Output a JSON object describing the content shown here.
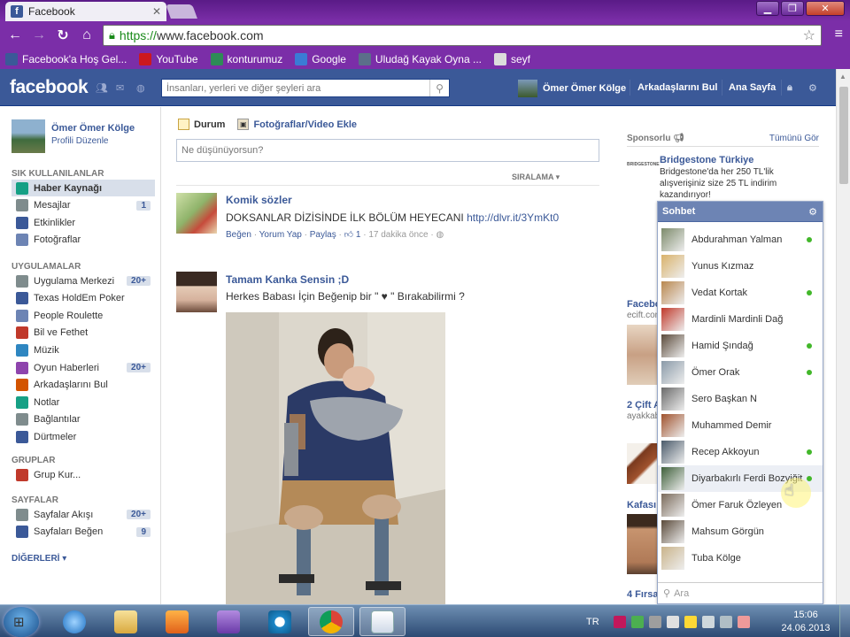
{
  "browser": {
    "tab_title": "Facebook",
    "url_scheme": "https://",
    "url_rest": "www.facebook.com",
    "bookmarks": [
      {
        "label": "Facebook'a Hoş Gel...",
        "icon": "facebook-icon",
        "color": "#3b5998"
      },
      {
        "label": "YouTube",
        "icon": "youtube-icon",
        "color": "#cc181e"
      },
      {
        "label": "konturumuz",
        "icon": "clover-icon",
        "color": "#2e8b57"
      },
      {
        "label": "Google",
        "icon": "google-icon",
        "color": "#3a7bd5"
      },
      {
        "label": "Uludağ Kayak Oyna ...",
        "icon": "ok-icon",
        "color": "#5b6f8a"
      },
      {
        "label": "seyf",
        "icon": "page-icon",
        "color": "#dcdcdc"
      }
    ]
  },
  "fb": {
    "logo": "facebook",
    "search_placeholder": "İnsanları, yerleri ve diğer şeyleri ara",
    "user_name": "Ömer Ömer Kölge",
    "nav_find_friends": "Arkadaşlarını Bul",
    "nav_home": "Ana Sayfa"
  },
  "left": {
    "profile_name": "Ömer Ömer Kölge",
    "profile_edit": "Profili Düzenle",
    "favorites_header": "SIK KULLANILANLAR",
    "favorites": [
      {
        "label": "Haber Kaynağı",
        "icon": "news-feed-icon",
        "count": ""
      },
      {
        "label": "Mesajlar",
        "icon": "messages-icon",
        "count": "1"
      },
      {
        "label": "Etkinlikler",
        "icon": "events-icon",
        "count": ""
      },
      {
        "label": "Fotoğraflar",
        "icon": "photos-icon",
        "count": ""
      }
    ],
    "apps_header": "UYGULAMALAR",
    "apps": [
      {
        "label": "Uygulama Merkezi",
        "icon": "app-center-icon",
        "count": "20+"
      },
      {
        "label": "Texas HoldEm Poker",
        "icon": "poker-chip-icon",
        "count": ""
      },
      {
        "label": "People Roulette",
        "icon": "roulette-icon",
        "count": ""
      },
      {
        "label": "Bil ve Fethet",
        "icon": "knight-icon",
        "count": ""
      },
      {
        "label": "Müzik",
        "icon": "music-icon",
        "count": ""
      },
      {
        "label": "Oyun Haberleri",
        "icon": "game-news-icon",
        "count": "20+"
      },
      {
        "label": "Arkadaşlarını Bul",
        "icon": "find-friends-icon",
        "count": ""
      },
      {
        "label": "Notlar",
        "icon": "notes-icon",
        "count": ""
      },
      {
        "label": "Bağlantılar",
        "icon": "links-icon",
        "count": ""
      },
      {
        "label": "Dürtmeler",
        "icon": "pokes-icon",
        "count": ""
      }
    ],
    "groups_header": "GRUPLAR",
    "groups": [
      {
        "label": "Grup Kur...",
        "icon": "create-group-icon",
        "count": ""
      }
    ],
    "pages_header": "SAYFALAR",
    "pages": [
      {
        "label": "Sayfalar Akışı",
        "icon": "pages-feed-icon",
        "count": "20+"
      },
      {
        "label": "Sayfaları Beğen",
        "icon": "like-pages-icon",
        "count": "9"
      }
    ],
    "more": "DİĞERLERİ"
  },
  "composer": {
    "tab_status": "Durum",
    "tab_photo": "Fotoğraflar/Video Ekle",
    "placeholder": "Ne düşünüyorsun?",
    "sort": "SIRALAMA"
  },
  "posts": [
    {
      "author": "Komik sözler",
      "text": "DOKSANLAR DİZİSİNDE İLK BÖLÜM HEYECANI",
      "link": "http://dlvr.it/3YmKt0",
      "like": "Beğen",
      "comment": "Yorum Yap",
      "share": "Paylaş",
      "likes_count": "1",
      "time": "17 dakika önce"
    },
    {
      "author": "Tamam Kanka Sensin ;D",
      "text": "Herkes Babası İçin Beğenip bir \" ♥ \" Bırakabilirmi ?"
    }
  ],
  "right": {
    "sponsored": "Sponsorlu",
    "see_all": "Tümünü Gör",
    "ad1_logo": "BRIDGESTONE",
    "ad1_title": "Bridgestone Türkiye",
    "ad1_text": "Bridgestone'da her 250 TL'lik alışverişiniz size 25 TL indirim kazandırıyor!",
    "ad2_title": "Facebo",
    "ad2_sub": "ecift.com",
    "ad3_title": "2 Çift A",
    "ad3_sub": "ayakkab",
    "ad4_title": "Kafası",
    "ad5_title": "4 Fırsa"
  },
  "chat": {
    "title": "Sohbet",
    "search_placeholder": "Ara",
    "friends": [
      {
        "name": "Abdurahman Yalman",
        "online": true
      },
      {
        "name": "Yunus Kızmaz",
        "online": false
      },
      {
        "name": "Vedat Kortak",
        "online": true
      },
      {
        "name": "Mardinli Mardinli Dağ",
        "online": false
      },
      {
        "name": "Hamid Şındağ",
        "online": true
      },
      {
        "name": "Ömer Orak",
        "online": true
      },
      {
        "name": "Sero Başkan N",
        "online": false
      },
      {
        "name": "Muhammed Demir",
        "online": false
      },
      {
        "name": "Recep Akkoyun",
        "online": true
      },
      {
        "name": "Diyarbakırlı Ferdi Bozyiğit",
        "online": true
      },
      {
        "name": "Ömer Faruk Özleyen",
        "online": false
      },
      {
        "name": "Mahsum Görgün",
        "online": false
      },
      {
        "name": "Tuba Kölge",
        "online": false
      }
    ]
  },
  "taskbar": {
    "lang": "TR",
    "time": "15:06",
    "date": "24.06.2013"
  }
}
